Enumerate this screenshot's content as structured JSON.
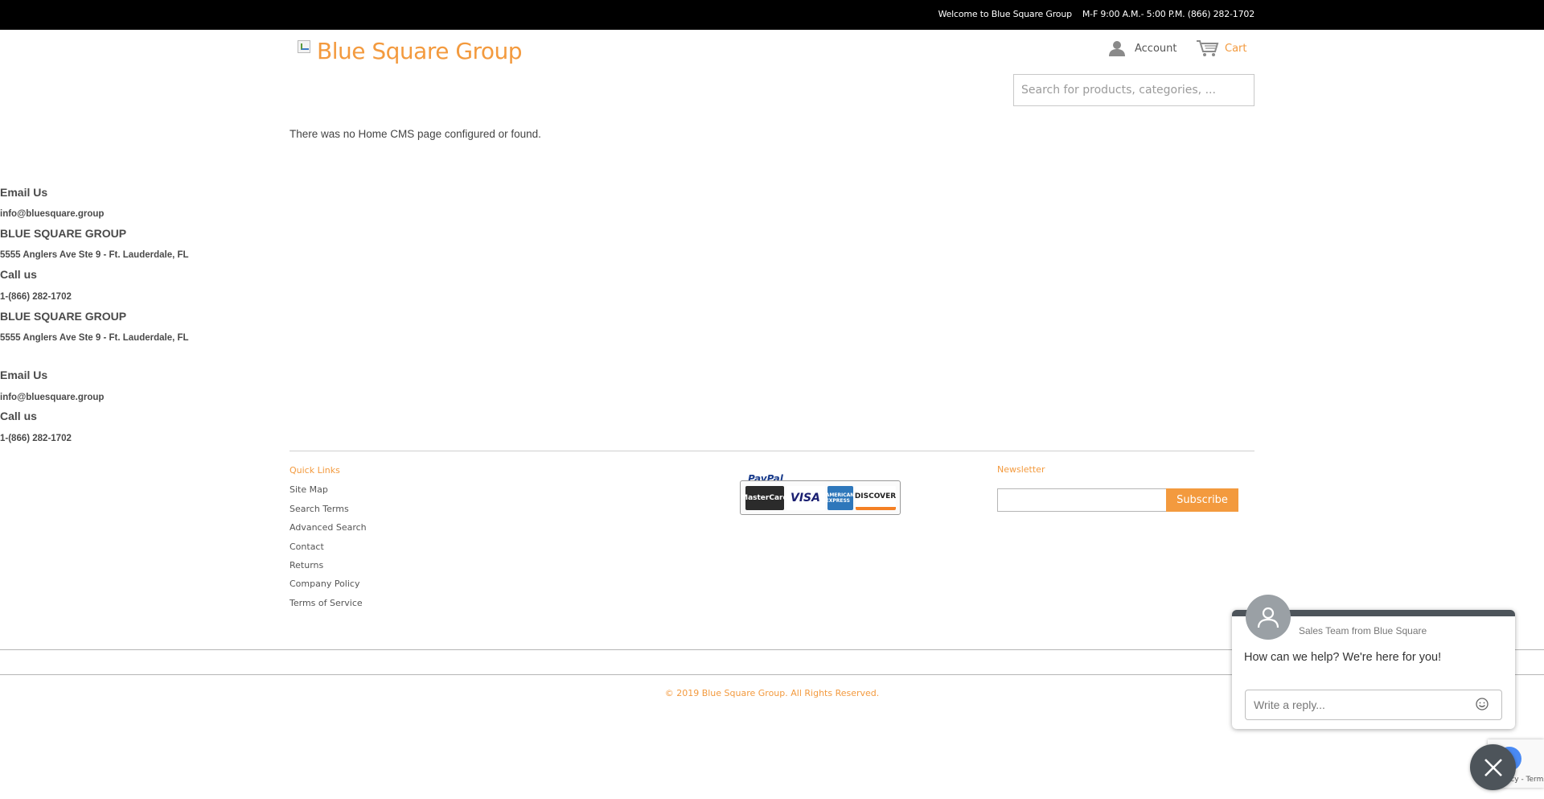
{
  "topbar": {
    "welcome": "Welcome to Blue Square Group",
    "hours": "M-F 9:00 A.M.- 5:00 P.M. (866) 282-1702"
  },
  "header": {
    "logo_text": "Blue Square Group",
    "account_label": "Account",
    "cart_label": "Cart",
    "search_placeholder": "Search for products, categories, ..."
  },
  "main": {
    "message": "There was no Home CMS page configured or found."
  },
  "contact_blocks": [
    {
      "heading": "Email Us",
      "value": "info@bluesquare.group"
    },
    {
      "heading": "BLUE SQUARE GROUP",
      "value": "5555 Anglers Ave Ste 9 - Ft. Lauderdale, FL"
    },
    {
      "heading": "Call us",
      "value": "1-(866) 282-1702"
    },
    {
      "heading": "BLUE SQUARE GROUP",
      "value": "5555 Anglers Ave Ste 9 - Ft. Lauderdale, FL"
    },
    {
      "heading": "Email Us",
      "value": "info@bluesquare.group"
    },
    {
      "heading": "Call us",
      "value": "1-(866) 282-1702"
    }
  ],
  "footer": {
    "quick_links_title": "Quick Links",
    "quick_links": [
      "Site Map",
      "Search Terms",
      "Advanced Search",
      "Contact",
      "Returns",
      "Company Policy",
      "Terms of Service"
    ],
    "payment": {
      "paypal": "PayPal",
      "cards": [
        "MasterCard",
        "VISA",
        "AMERICAN EXPRESS",
        "DISCOVER"
      ]
    },
    "newsletter_title": "Newsletter",
    "subscribe_label": "Subscribe",
    "copyright": "© 2019 Blue Square Group. All Rights Reserved."
  },
  "chat": {
    "agent": "Sales Team from Blue Square",
    "message": "How can we help? We're here for you!",
    "reply_placeholder": "Write a reply..."
  },
  "recaptcha": {
    "links": "Privacy - Terms"
  },
  "colors": {
    "accent": "#f39a3e",
    "topbar_bg": "#000000",
    "chat_dark": "#4d545a"
  }
}
